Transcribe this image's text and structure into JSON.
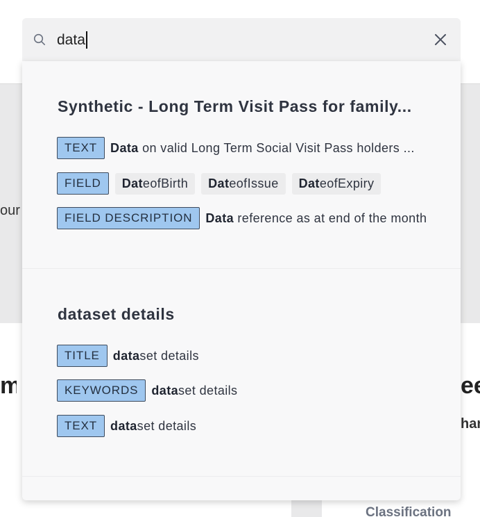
{
  "search": {
    "value": "data",
    "placeholder": ""
  },
  "background": {
    "left_mid_fragment": "our a",
    "left_big_fragment": "m",
    "right_big_fragment": "ee",
    "right_mid_fragment": "han",
    "classification_label": "Classification"
  },
  "results": [
    {
      "title": "Synthetic - Long Term Visit Pass for family...",
      "matches": [
        {
          "tag": "TEXT",
          "highlight": "Data",
          "rest": " on valid Long Term Social Visit Pass holders ..."
        },
        {
          "tag": "FIELD",
          "chips": [
            {
              "highlight": "Dat",
              "rest": "eofBirth"
            },
            {
              "highlight": "Dat",
              "rest": "eofIssue"
            },
            {
              "highlight": "Dat",
              "rest": "eofExpiry"
            }
          ]
        },
        {
          "tag": "FIELD DESCRIPTION",
          "highlight": "Data",
          "rest": " reference as at end of the month"
        }
      ]
    },
    {
      "title": "dataset details",
      "matches": [
        {
          "tag": "TITLE",
          "highlight": "data",
          "rest": "set details"
        },
        {
          "tag": "KEYWORDS",
          "highlight": "data",
          "rest": "set details"
        },
        {
          "tag": "TEXT",
          "highlight": "data",
          "rest": "set details"
        }
      ]
    }
  ],
  "colors": {
    "tag_bg": "#9fc7ef",
    "tag_border": "#3d4a5c",
    "dropdown_bg": "#f8f8f9",
    "search_bg": "#f1f1f2"
  },
  "icons": {
    "search": "search-icon",
    "clear": "close-icon"
  }
}
